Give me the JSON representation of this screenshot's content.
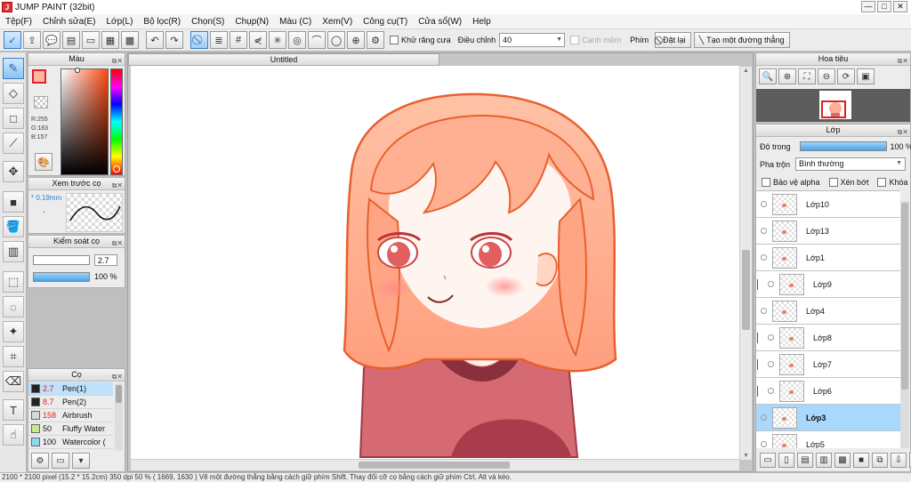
{
  "window": {
    "title": "JUMP PAINT (32bit)",
    "app_icon_letter": "J"
  },
  "window_buttons": [
    "—",
    "□",
    "✕"
  ],
  "menu": [
    "Tệp(F)",
    "Chỉnh sửa(E)",
    "Lớp(L)",
    "Bộ lọc(R)",
    "Chọn(S)",
    "Chụp(N)",
    "Màu (C)",
    "Xem(V)",
    "Công cụ(T)",
    "Cửa sổ(W)",
    "Help"
  ],
  "toolbar": {
    "antialias_label": "Khử răng cưa",
    "adjust_label": "Điều chỉnh",
    "adjust_value": "40",
    "canh_mem_label": "Cạnh mềm",
    "phim_label": "Phím",
    "reset_label": "Đặt lại",
    "line_label": "Tạo một đường thẳng"
  },
  "color_panel": {
    "title": "Màu",
    "r": "R:255",
    "g": "G:183",
    "b": "B:157",
    "fg": "#ffb79d"
  },
  "preview_panel": {
    "title": "Xem trước cọ",
    "size": "0.19mm"
  },
  "control_panel": {
    "title": "Kiểm soát cọ",
    "size_value": "2.7",
    "opacity_value": "100 %"
  },
  "canvas": {
    "tab_label": "Untitled"
  },
  "brush_panel": {
    "title": "Cọ",
    "items": [
      {
        "size": "2.7",
        "name": "Pen(1)",
        "color": "#222222",
        "selected": true,
        "red": true
      },
      {
        "size": "8.7",
        "name": "Pen(2)",
        "color": "#222222",
        "selected": false,
        "red": true
      },
      {
        "size": "158",
        "name": "Airbrush",
        "color": "#d9d9d9",
        "selected": false,
        "red": true
      },
      {
        "size": "50",
        "name": "Fluffy Water",
        "color": "#c8e88c",
        "selected": false,
        "red": false
      },
      {
        "size": "100",
        "name": "Watercolor (",
        "color": "#8fd8f4",
        "selected": false,
        "red": false
      }
    ]
  },
  "navigator_panel": {
    "title": "Hoa tiêu"
  },
  "layer_panel": {
    "title": "Lớp",
    "opacity_label": "Độ trong",
    "opacity_value": "100 %",
    "blend_label": "Pha trộn",
    "blend_value": "Bình thường",
    "protect_alpha": "Bảo vệ alpha",
    "clip": "Xén bớt",
    "lock": "Khóa",
    "layers": [
      {
        "name": "Lớp10",
        "selected": false,
        "indent": false
      },
      {
        "name": "Lớp13",
        "selected": false,
        "indent": false
      },
      {
        "name": "Lớp1",
        "selected": false,
        "indent": false
      },
      {
        "name": "Lớp9",
        "selected": false,
        "indent": true
      },
      {
        "name": "Lớp4",
        "selected": false,
        "indent": false
      },
      {
        "name": "Lớp8",
        "selected": false,
        "indent": true
      },
      {
        "name": "Lớp7",
        "selected": false,
        "indent": true
      },
      {
        "name": "Lớp6",
        "selected": false,
        "indent": true
      },
      {
        "name": "Lớp3",
        "selected": true,
        "indent": false
      },
      {
        "name": "Lớp5",
        "selected": false,
        "indent": false
      }
    ]
  },
  "status": {
    "text": "2100 * 2100 pixel   (15.2 * 15.2cm)   350 dpi   50 %   ( 1669, 1630 )   Vẽ một đường thẳng bằng cách giữ phím Shift. Thay đổi cỡ cọ bằng cách giữ phím Ctrl, Alt và kéo."
  }
}
